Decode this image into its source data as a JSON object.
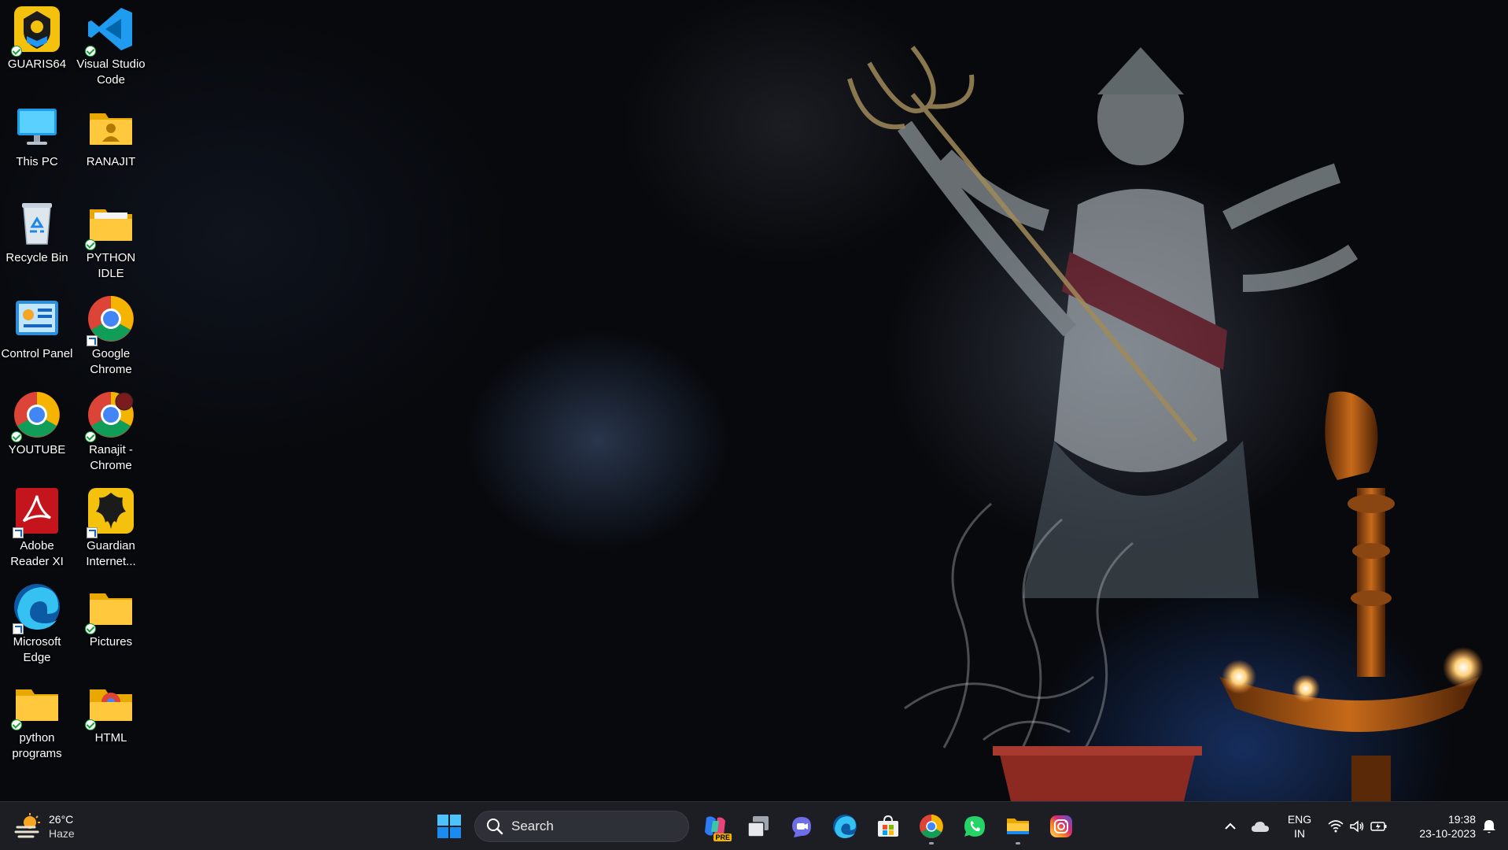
{
  "desktop": {
    "icons": [
      {
        "label": "GUARIS64"
      },
      {
        "label": "Visual Studio Code"
      },
      {
        "label": "This PC"
      },
      {
        "label": "RANAJIT"
      },
      {
        "label": "Recycle Bin"
      },
      {
        "label": "PYTHON IDLE"
      },
      {
        "label": "Control Panel"
      },
      {
        "label": "Google Chrome"
      },
      {
        "label": "YOUTUBE"
      },
      {
        "label": "Ranajit - Chrome"
      },
      {
        "label": "Adobe Reader XI"
      },
      {
        "label": "Guardian Internet..."
      },
      {
        "label": "Microsoft Edge"
      },
      {
        "label": "Pictures"
      },
      {
        "label": "python programs"
      },
      {
        "label": "HTML"
      }
    ]
  },
  "taskbar": {
    "weather": {
      "temperature": "26°C",
      "condition": "Haze",
      "icon": "sun-haze-icon"
    },
    "search": {
      "placeholder": "Search"
    },
    "pinned": [
      {
        "name": "Copilot",
        "icon": "copilot-icon",
        "badge": "PRE"
      },
      {
        "name": "Task View",
        "icon": "task-view-icon"
      },
      {
        "name": "Chat",
        "icon": "chat-icon"
      },
      {
        "name": "Microsoft Edge",
        "icon": "edge-icon"
      },
      {
        "name": "Microsoft Store",
        "icon": "store-icon"
      },
      {
        "name": "Google Chrome",
        "icon": "chrome-icon"
      },
      {
        "name": "WhatsApp",
        "icon": "whatsapp-icon"
      },
      {
        "name": "File Explorer",
        "icon": "file-explorer-icon"
      },
      {
        "name": "Instagram",
        "icon": "instagram-icon"
      }
    ],
    "tray": {
      "language_line1": "ENG",
      "language_line2": "IN",
      "time": "19:38",
      "date": "23-10-2023"
    }
  },
  "colors": {
    "taskbar_bg": "#1c1e24",
    "wallpaper_bg": "#07090d",
    "windows_blue": "#1a8cf0"
  }
}
